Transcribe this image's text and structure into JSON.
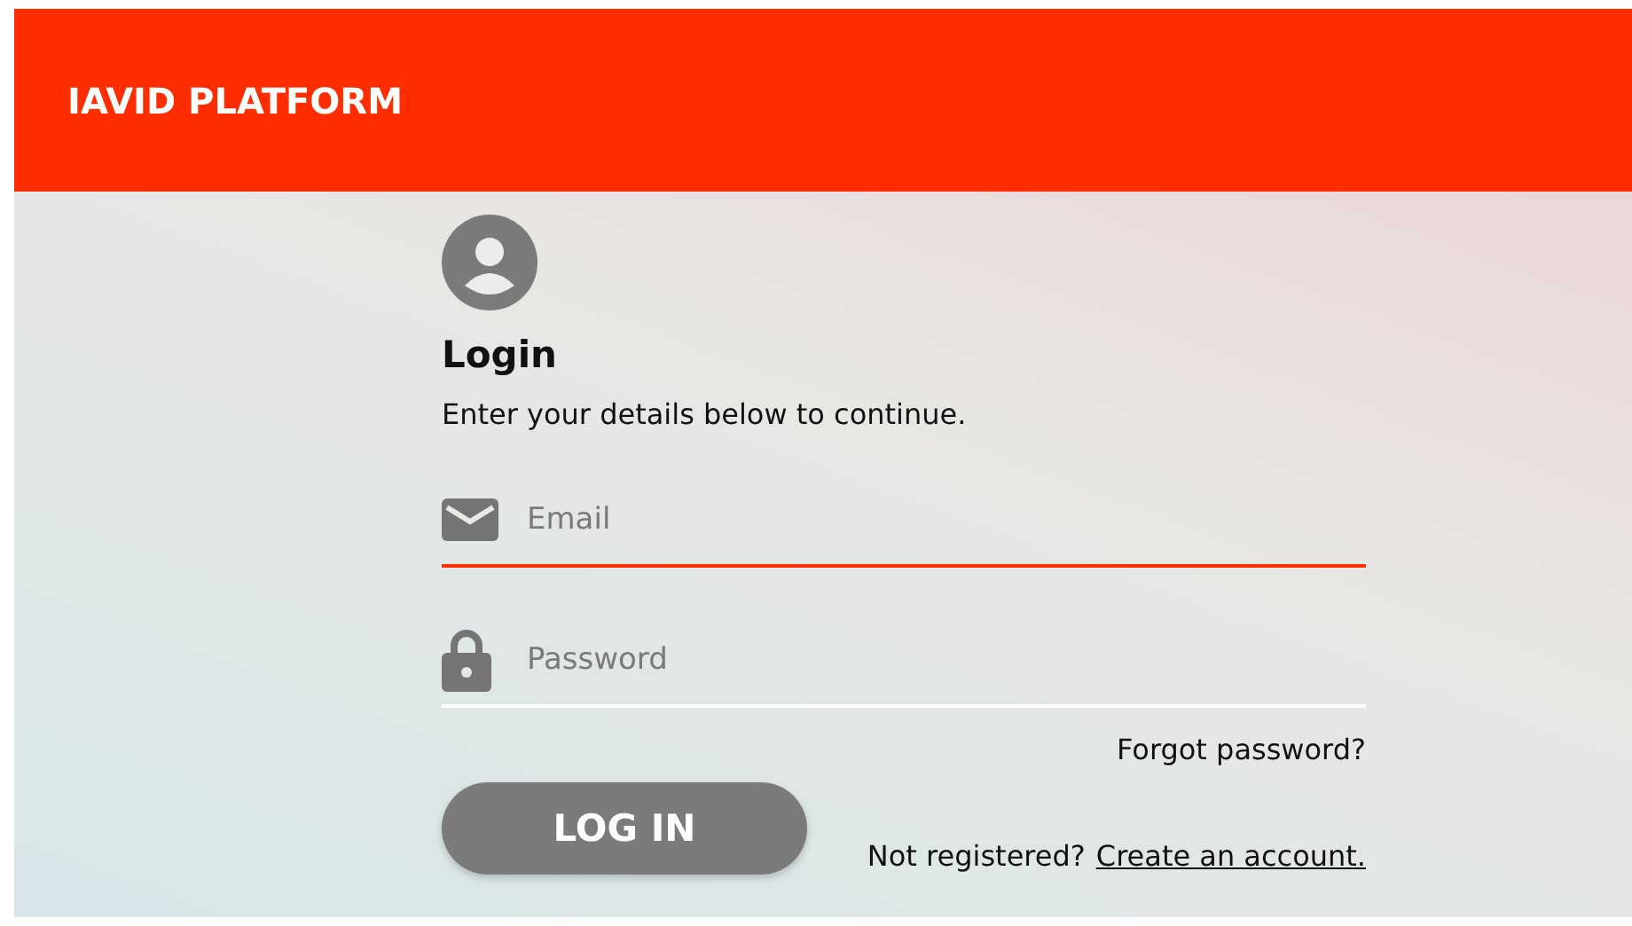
{
  "header": {
    "title": "IAVID PLATFORM"
  },
  "login": {
    "heading": "Login",
    "subtitle": "Enter your details below to continue.",
    "fields": [
      {
        "kind": "email",
        "placeholder": "Email",
        "focused": true
      },
      {
        "kind": "password",
        "placeholder": "Password",
        "focused": false
      }
    ],
    "forgot_link": "Forgot password?",
    "button": "LOG IN",
    "register_prompt": "Not registered?",
    "register_link": "Create an account."
  }
}
